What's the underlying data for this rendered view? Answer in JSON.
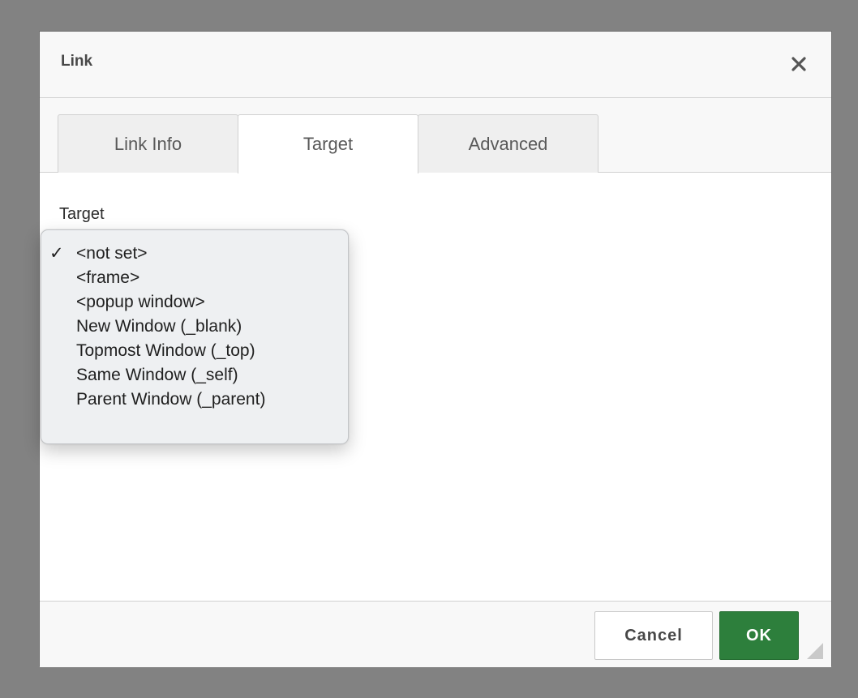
{
  "top_strip": {
    "text": ""
  },
  "dialog": {
    "title": "Link",
    "close_icon": "close-icon",
    "tabs": [
      {
        "label": "Link Info",
        "active": false
      },
      {
        "label": "Target",
        "active": true
      },
      {
        "label": "Advanced",
        "active": false
      }
    ],
    "target": {
      "label": "Target",
      "selected": "<not set>",
      "check_glyph": "✓",
      "options": [
        "<not set>",
        "<frame>",
        "<popup window>",
        "New Window (_blank)",
        "Topmost Window (_top)",
        "Same Window (_self)",
        "Parent Window (_parent)"
      ]
    },
    "buttons": {
      "cancel": "Cancel",
      "ok": "OK"
    },
    "resize_icon": "resize-grip-icon"
  },
  "colors": {
    "overlay": "#828282",
    "ok_button": "#2d7f3c",
    "dropdown_bg": "#eef0f2"
  }
}
